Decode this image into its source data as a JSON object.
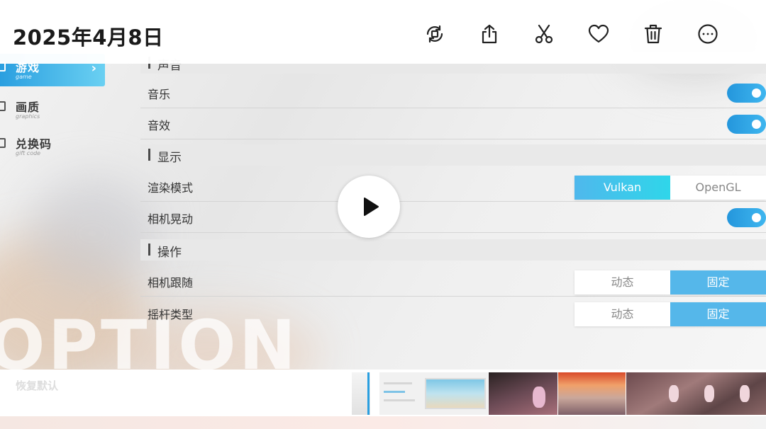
{
  "topbar": {
    "date": "2025年4月8日",
    "actions": [
      {
        "name": "rotate-icon"
      },
      {
        "name": "share-icon"
      },
      {
        "name": "cut-icon"
      },
      {
        "name": "favorite-icon"
      },
      {
        "name": "delete-icon"
      },
      {
        "name": "more-icon"
      }
    ]
  },
  "video": {
    "sidebar": [
      {
        "label": "游戏",
        "sub": "game",
        "active": true
      },
      {
        "label": "画质",
        "sub": "graphics",
        "active": false
      },
      {
        "label": "兑换码",
        "sub": "gift code",
        "active": false
      }
    ],
    "watermark": "OPTION",
    "sections": {
      "sound": "声音",
      "display": "显示",
      "control": "操作"
    },
    "rows": {
      "music": {
        "label": "音乐",
        "on": true
      },
      "sfx": {
        "label": "音效",
        "on": true
      },
      "render": {
        "label": "渲染模式",
        "options": [
          "Vulkan",
          "OpenGL"
        ],
        "selected": "Vulkan"
      },
      "camera_shake": {
        "label": "相机晃动",
        "on": true
      },
      "camera_follow": {
        "label": "相机跟随",
        "options": [
          "动态",
          "固定"
        ],
        "selected": "固定"
      },
      "joystick": {
        "label": "摇杆类型",
        "options": [
          "动态",
          "固定"
        ],
        "selected": "固定"
      }
    },
    "ghost_text": "恢复默认"
  },
  "colors": {
    "accent": "#2a9fe0",
    "toggle_on": "#2496dc",
    "selected_segment": "#4fb8ec"
  }
}
